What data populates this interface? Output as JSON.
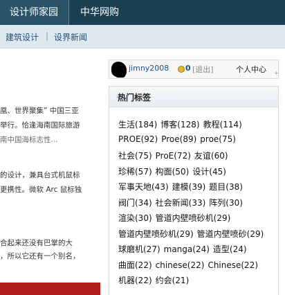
{
  "nav": {
    "items": [
      "设计师家园",
      "中华网购"
    ]
  },
  "subnav": {
    "links": [
      "建筑设计",
      "设界新闻"
    ],
    "separator": "|"
  },
  "content": {
    "lines": [
      "凰、世界聚集” 中国三亚",
      "举行。恰逢海南国际旅游",
      "南中国海标志性...",
      "的设计，兼具台式机鼠标",
      "更携性。微软 Arc 鼠标独",
      "合起来还没有巴掌的大",
      "，所以它还有一个别名，"
    ]
  },
  "user": {
    "name": "jimny2008",
    "coins": "0",
    "logout": "[退出]",
    "center": "个人中心",
    "corner_icon": "+"
  },
  "tags": {
    "title": "热门标签",
    "lines": [
      [
        "生活(184)",
        "博客(128)",
        "教程(114)"
      ],
      [
        "PROE(92)",
        "Proe(89)",
        "proe(75)"
      ],
      [
        "社会(75)",
        "ProE(72)",
        "友谊(60)"
      ],
      [
        "珍稀(57)",
        "构面(50)",
        "设计(45)"
      ],
      [
        "军事天地(43)",
        "建模(39)",
        "题目(38)"
      ],
      [
        "阀门(34)",
        "社会新闻(33)",
        "阵列(30)"
      ],
      [
        "渲染(30)",
        "管道内壁喷砂机(29)"
      ],
      [
        "管道内壁喷砂机(29)",
        "管道内壁喷砂(29)"
      ],
      [
        "球磨机(27)",
        "manga(24)",
        "造型(24)"
      ],
      [
        "曲面(22)",
        "chinese(22)",
        "Chinese(22)"
      ],
      [
        "机器(22)",
        "约会(21)"
      ]
    ]
  }
}
